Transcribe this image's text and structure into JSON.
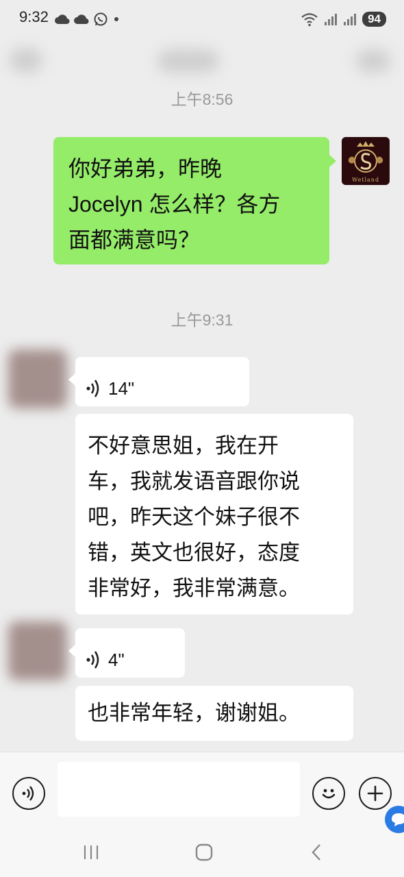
{
  "status_bar": {
    "time": "9:32",
    "battery": "94",
    "left_icons": [
      "cloud-icon",
      "cloud-icon",
      "whatsapp-icon",
      "dot-icon"
    ],
    "right_icons": [
      "wifi-icon",
      "signal-icon",
      "signal-icon",
      "battery-icon"
    ]
  },
  "chat": {
    "timestamp_1": "上午8:56",
    "outgoing_message": "你好弟弟，昨晚Jocelyn 怎么样？各方面都满意吗？",
    "outgoing_lines": [
      "你好弟弟，昨晚",
      "Jocelyn 怎么样？各方",
      "面都满意吗？"
    ],
    "self_avatar_text": "Wetland",
    "timestamp_2": "上午9:31",
    "voice_1": "14\"",
    "transcript_1_lines": [
      "不好意思姐，我在开",
      "车，我就发语音跟你说",
      "吧，昨天这个妹子很不",
      "错，英文也很好，态度",
      "非常好，我非常满意。"
    ],
    "voice_2": "4\"",
    "transcript_2": "也非常年轻，谢谢姐。"
  },
  "input_bar": {
    "text_value": "",
    "left_icon": "voice-input-icon",
    "right_icons": [
      "emoji-icon",
      "plus-icon"
    ]
  },
  "nav_bar": {
    "icons": [
      "recents-icon",
      "home-icon",
      "back-icon"
    ]
  },
  "colors": {
    "background": "#ededed",
    "outgoing_bubble": "#95ec69",
    "incoming_bubble": "#ffffff",
    "accent_blue": "#2b7be4"
  }
}
